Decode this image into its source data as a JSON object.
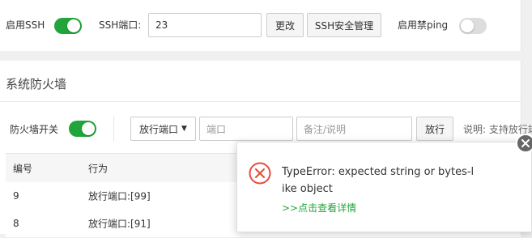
{
  "ssh_bar": {
    "enable_ssh_label": "启用SSH",
    "enable_ssh_on": true,
    "port_label": "SSH端口:",
    "port_value": "23",
    "change_button": "更改",
    "security_button": "SSH安全管理",
    "disable_ping_label": "启用禁ping",
    "disable_ping_on": false
  },
  "firewall": {
    "title": "系统防火墙",
    "switch_label": "防火墙开关",
    "switch_on": true,
    "rule_select": "放行端口",
    "port_placeholder": "端口",
    "note_placeholder": "备注/说明",
    "allow_button": "放行",
    "hint": "说明: 支持放行端"
  },
  "table": {
    "columns": [
      "编号",
      "行为"
    ],
    "rows": [
      {
        "id": "9",
        "action": "放行端口:[99]"
      },
      {
        "id": "8",
        "action": "放行端口:[91]"
      }
    ]
  },
  "toast": {
    "message": "TypeError: expected string or bytes-like object",
    "link": ">>点击查看详情",
    "icon": "error-circle-icon",
    "close_icon": "close-icon"
  },
  "colors": {
    "accent": "#20a53a",
    "error": "#e74c3c"
  }
}
